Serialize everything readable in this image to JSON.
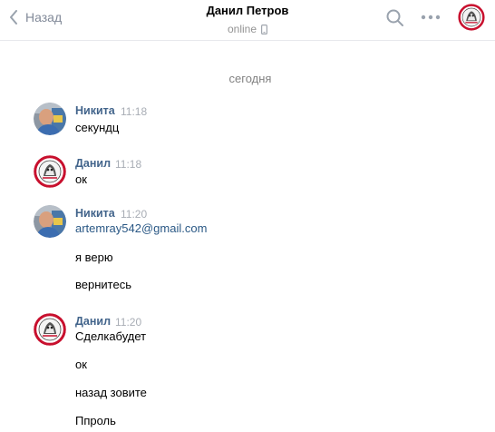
{
  "header": {
    "back_label": "Назад",
    "title": "Данил Петров",
    "status": "online"
  },
  "date_separator": "сегодня",
  "messages": [
    {
      "author": "Никита",
      "time": "11:18",
      "lines": [
        "секундц"
      ]
    },
    {
      "author": "Данил",
      "time": "11:18",
      "lines": [
        "ок"
      ]
    },
    {
      "author": "Никита",
      "time": "11:20",
      "lines": [
        "artemray542@gmail.com",
        "я верю",
        "вернитесь"
      ]
    },
    {
      "author": "Данил",
      "time": "11:20",
      "lines": [
        "Сделкабудет",
        "ок",
        "назад зовите",
        "Ппроль"
      ]
    }
  ],
  "icons": {
    "back": "chevron-left-icon",
    "phone": "mobile-phone-icon",
    "search": "search-icon",
    "more": "more-dots-icon"
  },
  "colors": {
    "author_name": "#42648b",
    "link": "#2a5885",
    "muted": "#828a99",
    "time": "#a8adb5",
    "divider": "#e7e8ec"
  }
}
